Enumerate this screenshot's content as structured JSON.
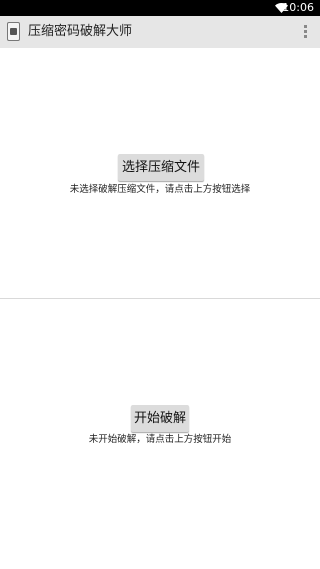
{
  "status_bar": {
    "time": "10:06",
    "wifi_icon": "wifi-icon"
  },
  "action_bar": {
    "title": "压缩密码破解大师",
    "app_icon": "app-icon",
    "menu_icon": "overflow-menu-icon",
    "background": "#e6e6e6"
  },
  "select_section": {
    "button_label": "选择压缩文件",
    "status": "未选择破解压缩文件，请点击上方按钮选择"
  },
  "crack_section": {
    "button_label": "开始破解",
    "status": "未开始破解，请点击上方按钮开始"
  }
}
